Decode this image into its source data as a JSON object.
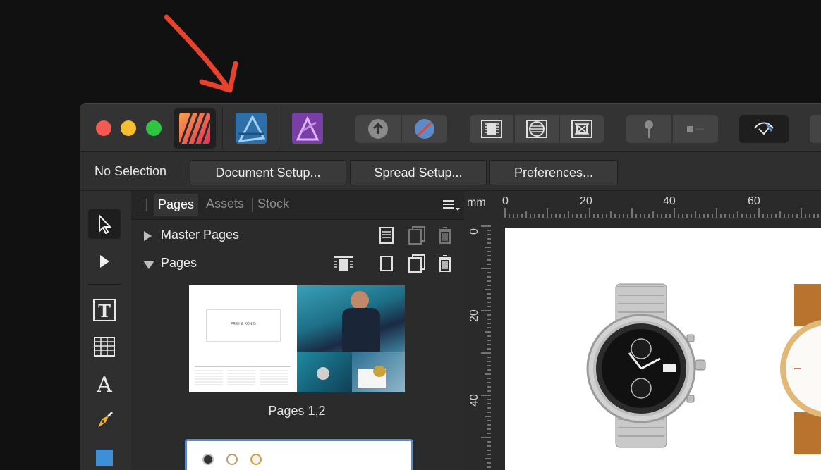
{
  "titlebar": {
    "personas": [
      {
        "name": "Affinity Publisher",
        "color": "#f15a29"
      },
      {
        "name": "Affinity Designer",
        "color": "#1b72be"
      },
      {
        "name": "Affinity Photo",
        "color": "#7e4dd2"
      }
    ]
  },
  "context_bar": {
    "selection_label": "No Selection",
    "buttons": [
      "Document Setup...",
      "Spread Setup...",
      "Preferences..."
    ]
  },
  "panel": {
    "tabs": [
      "Pages",
      "Assets",
      "Stock"
    ],
    "active_tab": "Pages",
    "sections": {
      "master_pages": "Master Pages",
      "pages": "Pages"
    },
    "thumbnails": [
      {
        "caption": "Pages 1,2",
        "brand_text": "FREY & KÖNIG"
      }
    ]
  },
  "canvas": {
    "units": "mm",
    "hruler_labels": [
      "0",
      "20",
      "40",
      "60"
    ],
    "vruler_labels": [
      "0",
      "20",
      "40"
    ]
  },
  "colors": {
    "annotation_arrow": "#e8412c",
    "selection_outline": "#5c87c9"
  }
}
